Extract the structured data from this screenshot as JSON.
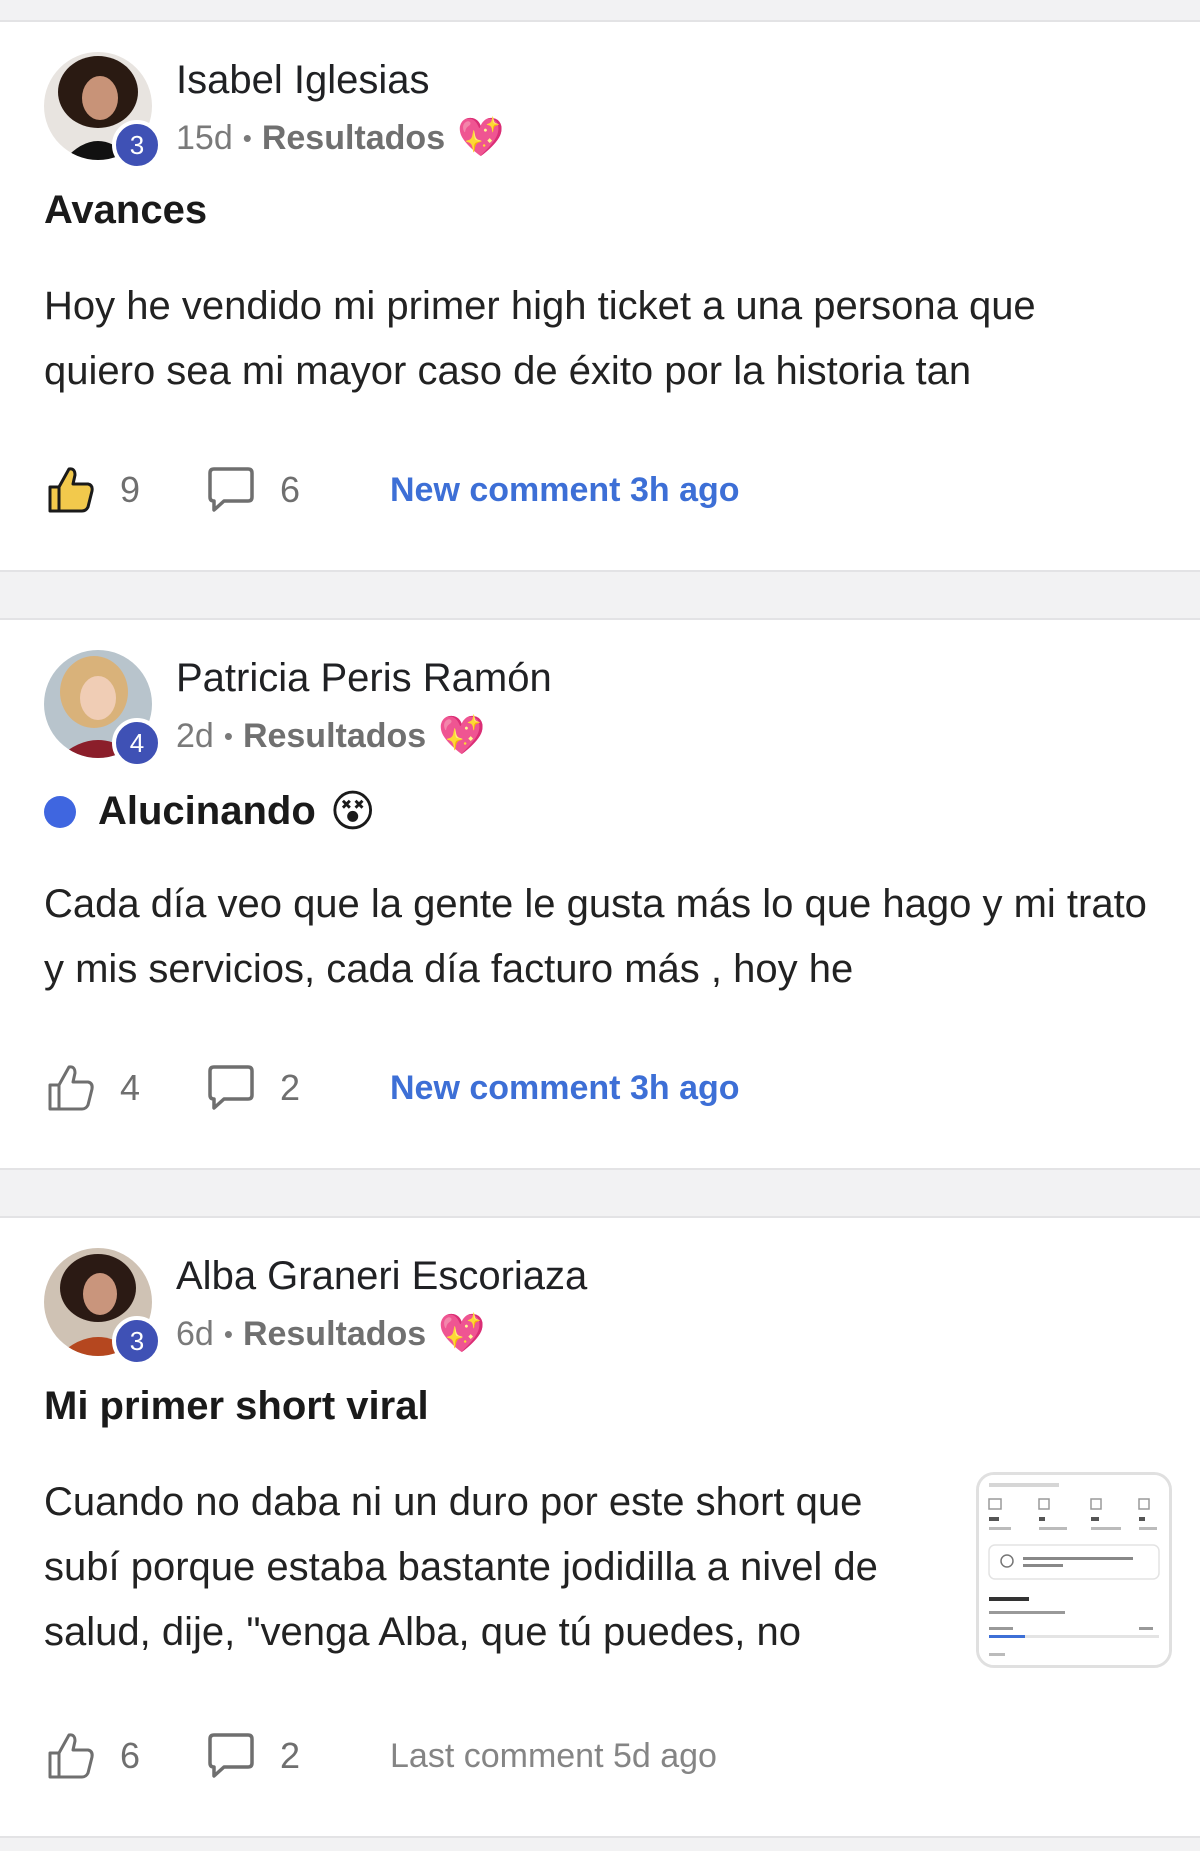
{
  "posts": [
    {
      "author": "Isabel Iglesias",
      "level": "3",
      "time": "15d",
      "separator": "•",
      "category": "Resultados",
      "category_emoji": "💖",
      "title": "Avances",
      "title_emoji": "",
      "unread": false,
      "body": "Hoy he vendido mi primer high ticket a una persona que quiero sea mi mayor caso de éxito por la historia tan",
      "likes": "9",
      "liked": true,
      "comments": "6",
      "comment_status": "New comment 3h ago",
      "comment_status_new": true
    },
    {
      "author": "Patricia Peris Ramón",
      "level": "4",
      "time": "2d",
      "separator": "•",
      "category": "Resultados",
      "category_emoji": "💖",
      "title": "Alucinando",
      "title_emoji": "😵",
      "unread": true,
      "body": "Cada día veo que la gente le gusta más lo que hago y mi trato y mis servicios, cada día facturo más , hoy he",
      "likes": "4",
      "liked": false,
      "comments": "2",
      "comment_status": "New comment 3h ago",
      "comment_status_new": true
    },
    {
      "author": "Alba Graneri Escoriaza",
      "level": "3",
      "time": "6d",
      "separator": "•",
      "category": "Resultados",
      "category_emoji": "💖",
      "title": "Mi primer short viral",
      "title_emoji": "",
      "unread": false,
      "body": "Cuando no daba ni un duro por este short que subí porque estaba bastante jodidilla a nivel de salud, dije, \"venga Alba, que tú puedes, no",
      "likes": "6",
      "liked": false,
      "comments": "2",
      "comment_status": "Last comment 5d ago",
      "comment_status_new": false,
      "has_thumbnail": true
    }
  ],
  "icons": {
    "like": "thumbs-up-icon",
    "comment": "speech-bubble-icon",
    "category": "sparkling-heart-icon"
  },
  "colors": {
    "link_new": "#3d6fd6",
    "link_muted": "#858585",
    "badge": "#3f51b5",
    "unread_dot": "#3f66e0"
  }
}
